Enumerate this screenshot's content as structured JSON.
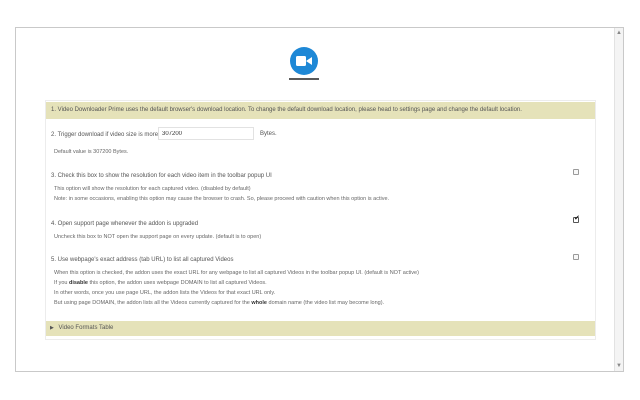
{
  "colors": {
    "accent": "#1e88d6",
    "banner_bg": "#e5e2b9"
  },
  "logo": {
    "icon": "video-camera-icon"
  },
  "banner": {
    "text": "1. Video Downloader Prime uses the default browser's download location. To change the default download location, please head to settings page and change the default location."
  },
  "trigger": {
    "label": "2. Trigger download if video size is more than",
    "value": "307200",
    "unit": "Bytes.",
    "note": "Default value is 307200 Bytes."
  },
  "resolution": {
    "label": "3. Check this box to show the resolution for each video item in the toolbar popup UI",
    "note1": "This option will show the resolution for each captured video. (disabled by default)",
    "note2": "Note: in some occasions, enabling this option may cause the browser to crash. So, please proceed with caution when this option is active.",
    "checked": false
  },
  "support": {
    "label": "4. Open support page whenever the addon is upgraded",
    "note": "Uncheck this box to NOT open the support page on every update. (default is to open)",
    "checked": true
  },
  "exact": {
    "label": "5. Use webpage's exact address (tab URL) to list all captured Videos",
    "note1": "When this option is checked, the addon uses the exact URL for any webpage to list all captured Videos in the toolbar popup UI. (default is NOT active)",
    "note2_prefix": "If you",
    "note2_bold": "disable",
    "note2_suffix": "this option, the addon uses webpage DOMAIN to list all captured Videos.",
    "note3": "In other words, once you use page URL, the addon lists the Videos for that exact URL only.",
    "note4_prefix": "But using page DOMAIN, the addon lists all the Videos currently captured for the",
    "note4_bold": "whole",
    "note4_suffix": "domain name (the video list may become long).",
    "checked": false
  },
  "formats": {
    "label": "Video Formats Table"
  }
}
